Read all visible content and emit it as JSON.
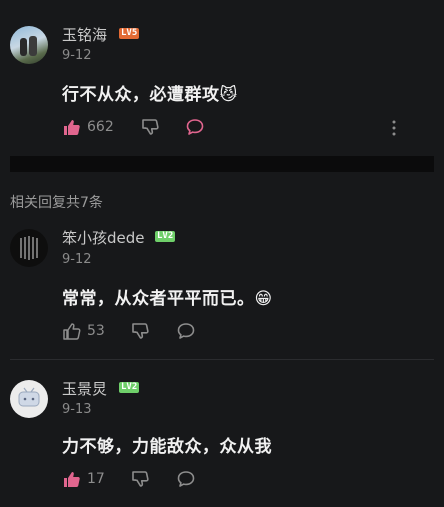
{
  "colors": {
    "bg": "#17181a",
    "lv5": "#e26a34",
    "lv2": "#6fcf6a",
    "like_active": "#e0658e"
  },
  "main_comment": {
    "user": "玉铭海",
    "level": "LV5",
    "date": "9-12",
    "text": "行不从众，必遭群攻",
    "emoji": "😼",
    "likes": "662"
  },
  "replies_header": "相关回复共7条",
  "replies": [
    {
      "user": "笨小孩dede",
      "level": "LV2",
      "date": "9-12",
      "text": "常常，从众者平平而已。",
      "emoji": "😁",
      "likes": "53"
    },
    {
      "user": "玉景炅",
      "level": "LV2",
      "date": "9-13",
      "text": "力不够，力能敌众，众从我",
      "emoji": "",
      "likes": "17"
    }
  ],
  "icons": [
    "thumb-up-icon",
    "thumb-down-icon",
    "comment-icon",
    "more-icon"
  ]
}
